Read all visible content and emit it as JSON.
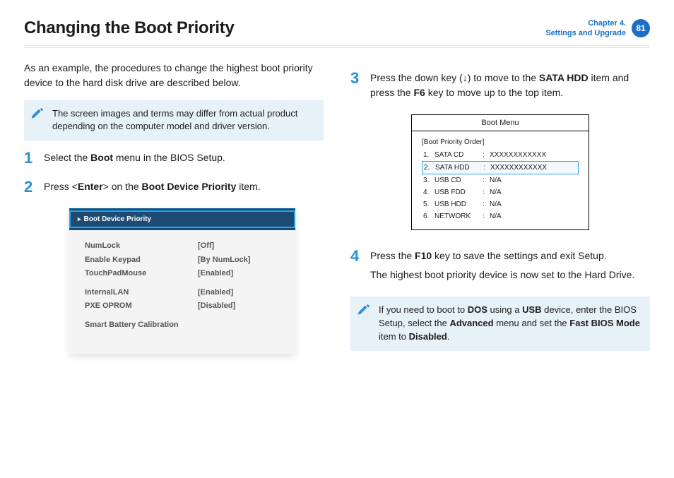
{
  "header": {
    "title": "Changing the Boot Priority",
    "chapter_line1": "Chapter 4.",
    "chapter_line2": "Settings and Upgrade",
    "page_number": "81"
  },
  "intro": "As an example, the procedures to change the highest boot priority device to the hard disk drive are described below.",
  "note1": "The screen images and terms may differ from actual product depending on the computer model and driver version.",
  "steps": {
    "s1_pre": "Select the ",
    "s1_bold": "Boot",
    "s1_post": " menu in the BIOS Setup.",
    "s2_pre": "Press <",
    "s2_b1": "Enter",
    "s2_mid": "> on the ",
    "s2_b2": "Boot Device Priority",
    "s2_post": " item.",
    "s3_pre": "Press the down key (↓) to move to the ",
    "s3_b1": "SATA HDD",
    "s3_mid": " item and press the ",
    "s3_b2": "F6",
    "s3_post": " key to move up to the top item.",
    "s4_pre": "Press the ",
    "s4_b1": "F10",
    "s4_post": " key to save the settings and exit Setup.",
    "s4_line2": "The highest boot priority device is now set to the Hard Drive."
  },
  "note2": {
    "pre": "If you need to boot to ",
    "b1": "DOS",
    "mid1": " using a ",
    "b2": "USB",
    "mid2": " device, enter the BIOS Setup, select the ",
    "b3": "Advanced",
    "mid3": " menu and set the ",
    "b4": "Fast BIOS Mode",
    "mid4": " item to ",
    "b5": "Disabled",
    "post": "."
  },
  "bios_box": {
    "header": "Boot Device Priority",
    "rows": [
      {
        "k": "NumLock",
        "v": "[Off]"
      },
      {
        "k": "Enable Keypad",
        "v": "[By NumLock]"
      },
      {
        "k": "TouchPadMouse",
        "v": "[Enabled]"
      }
    ],
    "rows2": [
      {
        "k": "InternalLAN",
        "v": "[Enabled]"
      },
      {
        "k": "PXE OPROM",
        "v": "[Disabled]"
      }
    ],
    "rows3": [
      {
        "k": "Smart Battery Calibration",
        "v": ""
      }
    ]
  },
  "boot_menu": {
    "title": "Boot Menu",
    "label": "[Boot Priority Order]",
    "items": [
      {
        "n": "1.",
        "d": "SATA CD",
        "v": "XXXXXXXXXXXX",
        "sel": false
      },
      {
        "n": "2.",
        "d": "SATA HDD",
        "v": "XXXXXXXXXXXX",
        "sel": true
      },
      {
        "n": "3.",
        "d": "USB CD",
        "v": "N/A",
        "sel": false
      },
      {
        "n": "4.",
        "d": "USB FDD",
        "v": "N/A",
        "sel": false
      },
      {
        "n": "5.",
        "d": "USB HDD",
        "v": "N/A",
        "sel": false
      },
      {
        "n": "6.",
        "d": "NETWORK",
        "v": "N/A",
        "sel": false
      }
    ]
  },
  "step_numbers": {
    "n1": "1",
    "n2": "2",
    "n3": "3",
    "n4": "4"
  }
}
